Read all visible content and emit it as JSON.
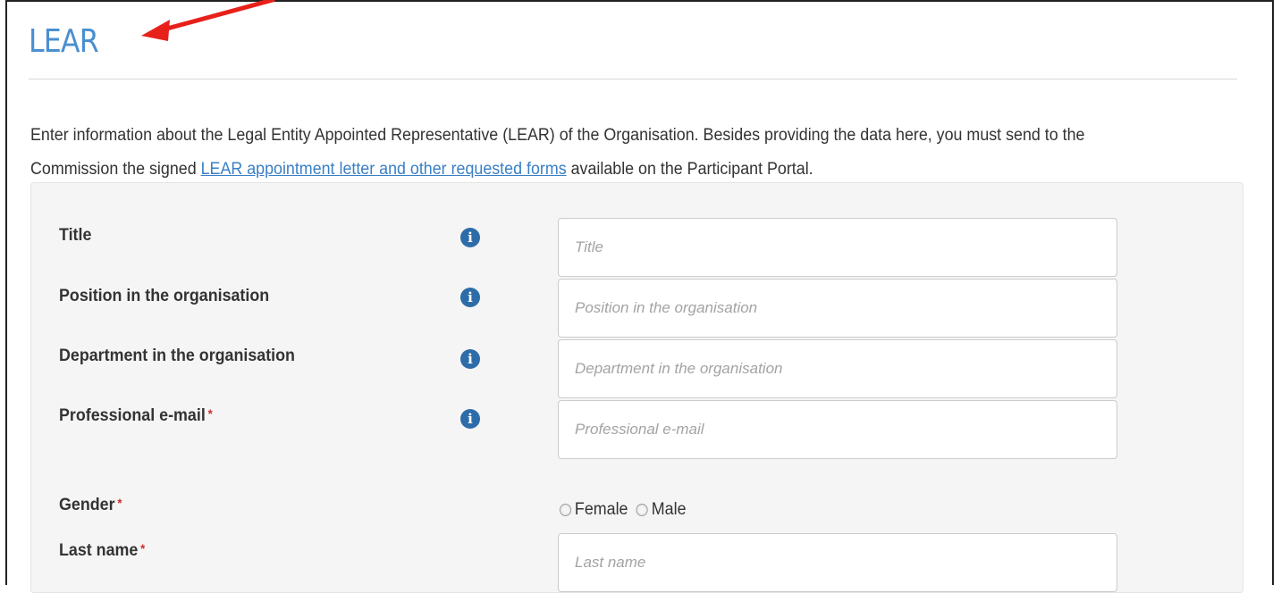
{
  "section": {
    "title": "LEAR"
  },
  "intro": {
    "text_before": "Enter information about the Legal Entity Appointed Representative (LEAR) of the Organisation. Besides providing the data here, you must send to the Commission the signed ",
    "link_text": "LEAR appointment letter and other requested forms",
    "text_after": " available on the Participant Portal."
  },
  "form": {
    "required_marker": "*",
    "info_glyph": "i",
    "fields": [
      {
        "label": "Title",
        "placeholder": "Title",
        "value": ""
      },
      {
        "label": "Position in the organisation",
        "placeholder": "Position in the organisation",
        "value": ""
      },
      {
        "label": "Department in the organisation",
        "placeholder": "Department in the organisation",
        "value": ""
      },
      {
        "label": "Professional e-mail",
        "placeholder": "Professional e-mail",
        "value": ""
      },
      {
        "label": "Last name",
        "placeholder": "Last name",
        "value": ""
      }
    ],
    "gender": {
      "label": "Gender",
      "options": [
        "Female",
        "Male"
      ],
      "selected": ""
    }
  },
  "colors": {
    "title": "#4a8fd0",
    "link": "#3a7fc4",
    "required": "#c9302c",
    "info_icon": "#2d6ca8",
    "annotation_arrow": "#e8201a"
  },
  "icons": {
    "info": "info-circle-icon",
    "annotation": "red-arrow-icon"
  }
}
